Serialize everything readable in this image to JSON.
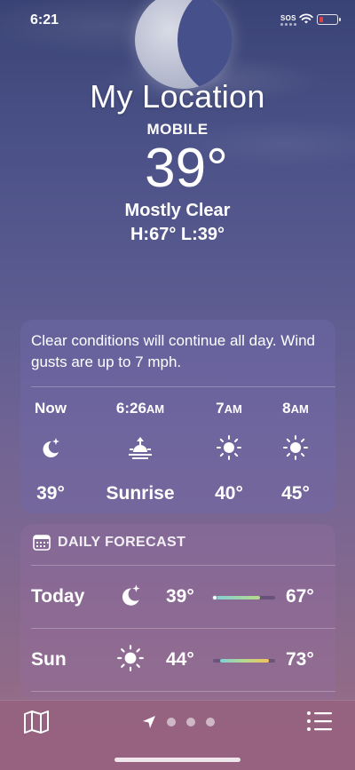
{
  "status_bar": {
    "time": "6:21",
    "carrier": "SOS"
  },
  "header": {
    "title": "My Location",
    "subtitle": "MOBILE",
    "temperature": "39°",
    "condition": "Mostly Clear",
    "high_low": "H:67°  L:39°"
  },
  "hourly": {
    "summary": "Clear conditions will continue all day. Wind gusts are up to 7 mph.",
    "items": [
      {
        "label": "Now",
        "suffix": "",
        "icon": "moon-stars-icon",
        "value": "39°"
      },
      {
        "label": "6:26",
        "suffix": "AM",
        "icon": "sunrise-icon",
        "value": "Sunrise"
      },
      {
        "label": "7",
        "suffix": "AM",
        "icon": "sun-icon",
        "value": "40°"
      },
      {
        "label": "8",
        "suffix": "AM",
        "icon": "sun-icon",
        "value": "45°"
      }
    ]
  },
  "daily": {
    "heading": "DAILY FORECAST",
    "rows": [
      {
        "day": "Today",
        "icon": "moon-stars-icon",
        "low": "39°",
        "high": "67°",
        "range_start": 0.0,
        "range_end": 0.75,
        "current_marker": 0.0
      },
      {
        "day": "Sun",
        "icon": "sun-icon",
        "low": "44°",
        "high": "73°",
        "range_start": 0.12,
        "range_end": 0.9
      }
    ]
  },
  "bottom_bar": {
    "page_count": 3,
    "active_page": "location"
  },
  "colors": {
    "bar_low": "#7fd0d8",
    "bar_mid": "#b7d98a",
    "bar_high": "#f2c25a"
  }
}
